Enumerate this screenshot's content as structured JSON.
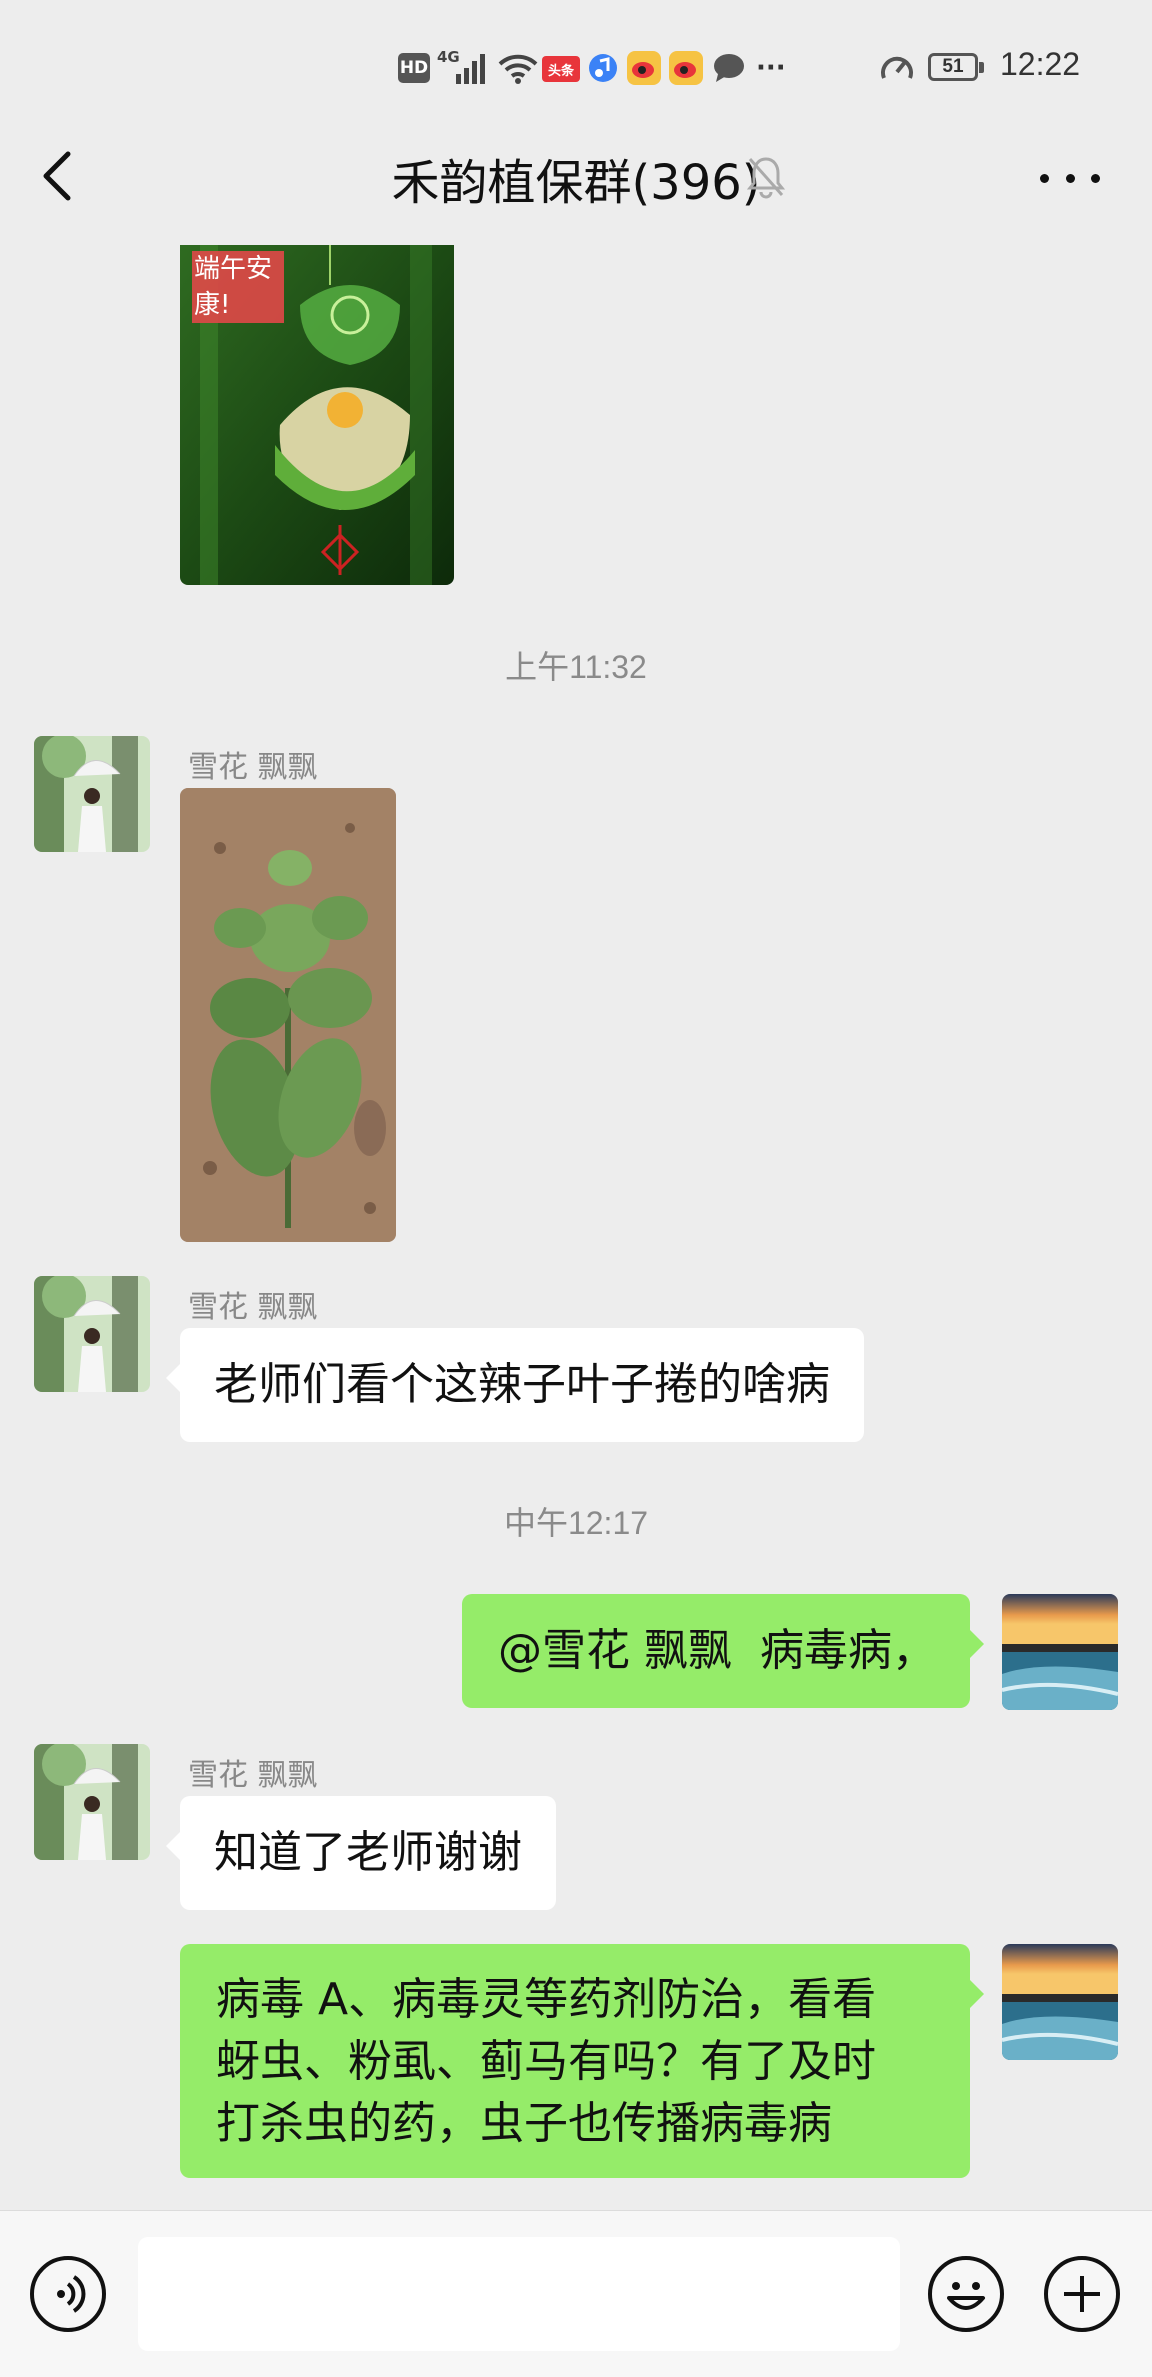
{
  "status_bar": {
    "hd": "HD",
    "network": "4G",
    "app_badge": "头条",
    "battery": "51",
    "time": "12:22",
    "more": "···"
  },
  "header": {
    "title": "禾韵植保群(396)"
  },
  "messages": {
    "image1_caption": "端午安康!",
    "timestamp1": "上午11:32",
    "sender1": "雪花 飘飘",
    "sender2": "雪花 飘飘",
    "text1": "老师们看个这辣子叶子捲的啥病",
    "timestamp2": "中午12:17",
    "mention": "@雪花 飘飘",
    "reply1": "病毒病，",
    "sender3": "雪花 飘飘",
    "text2": "知道了老师谢谢",
    "reply2": [
      "病毒 A、病毒灵等药剂防治，看看",
      "蚜虫、粉虱、蓟马有吗？有了及时",
      "打杀虫的药，虫子也传播病毒病"
    ]
  },
  "input": {
    "value": ""
  },
  "colors": {
    "background": "#ededed",
    "outgoing_bubble": "#95ec69",
    "incoming_bubble": "#ffffff"
  }
}
